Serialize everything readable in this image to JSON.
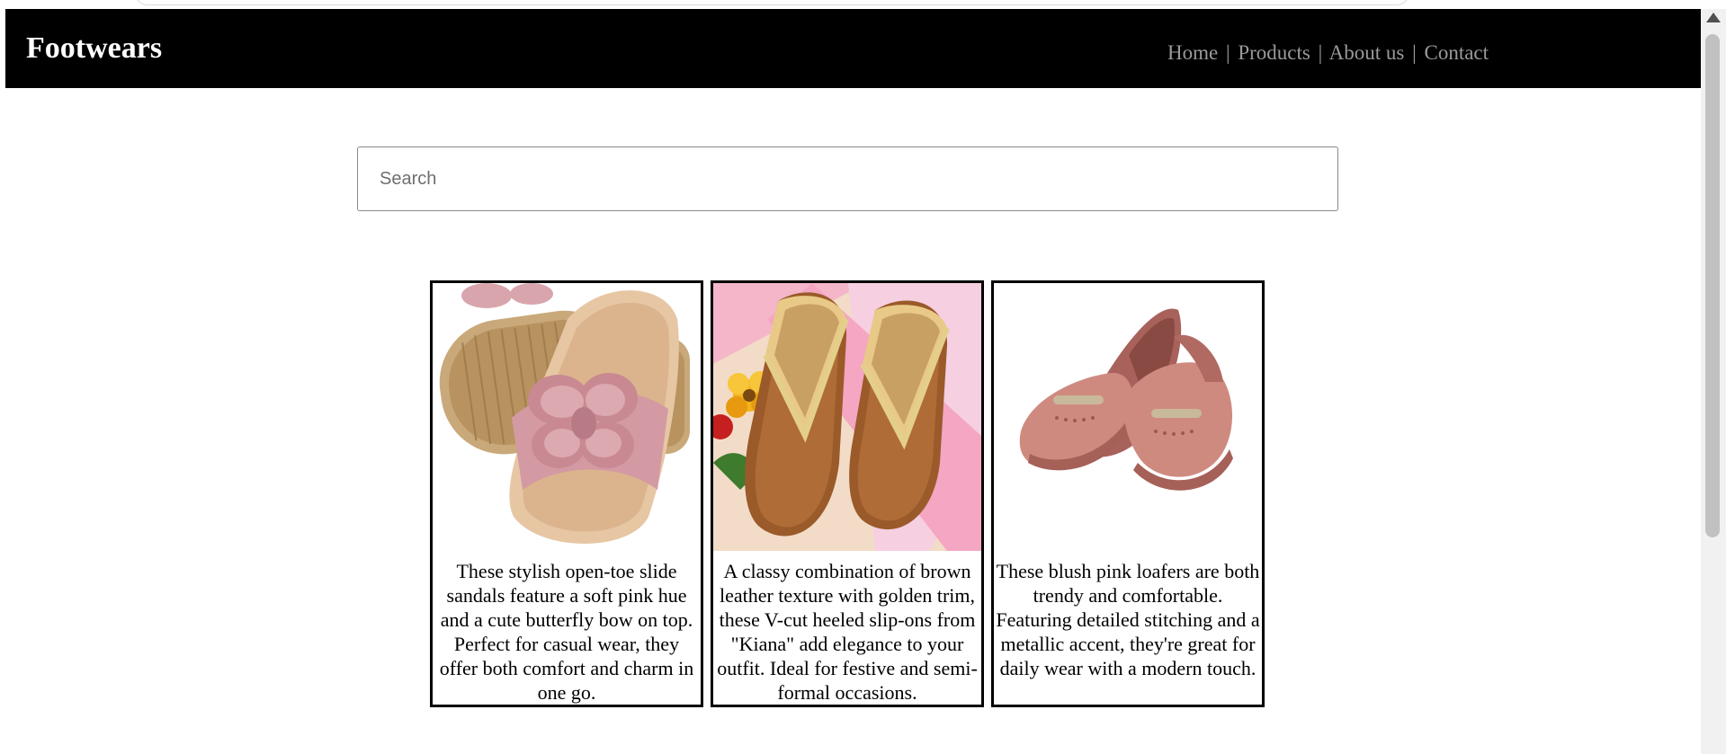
{
  "header": {
    "brand": "Footwears",
    "nav": {
      "home": "Home",
      "products": "Products",
      "about": "About us",
      "contact": "Contact",
      "separator": "|"
    },
    "colors": {
      "background": "#000000",
      "brand_text": "#ffffff",
      "nav_text": "#9a9a9a"
    }
  },
  "search": {
    "placeholder": "Search",
    "value": ""
  },
  "products": [
    {
      "image_icon": "pink-butterfly-slide-sandal-image",
      "description": "These stylish open-toe slide sandals feature a soft pink hue and a cute butterfly bow on top. Perfect for casual wear, they offer both comfort and charm in one go."
    },
    {
      "image_icon": "brown-v-cut-heeled-slipon-image",
      "description": "A classy combination of brown leather texture with golden trim, these V-cut heeled slip-ons from \"Kiana\" add elegance to your outfit. Ideal for festive and semi-formal occasions."
    },
    {
      "image_icon": "blush-pink-loafer-image",
      "description": "These blush pink loafers are both trendy and comfortable. Featuring detailed stitching and a metallic accent, they're great for daily wear with a modern touch."
    }
  ]
}
